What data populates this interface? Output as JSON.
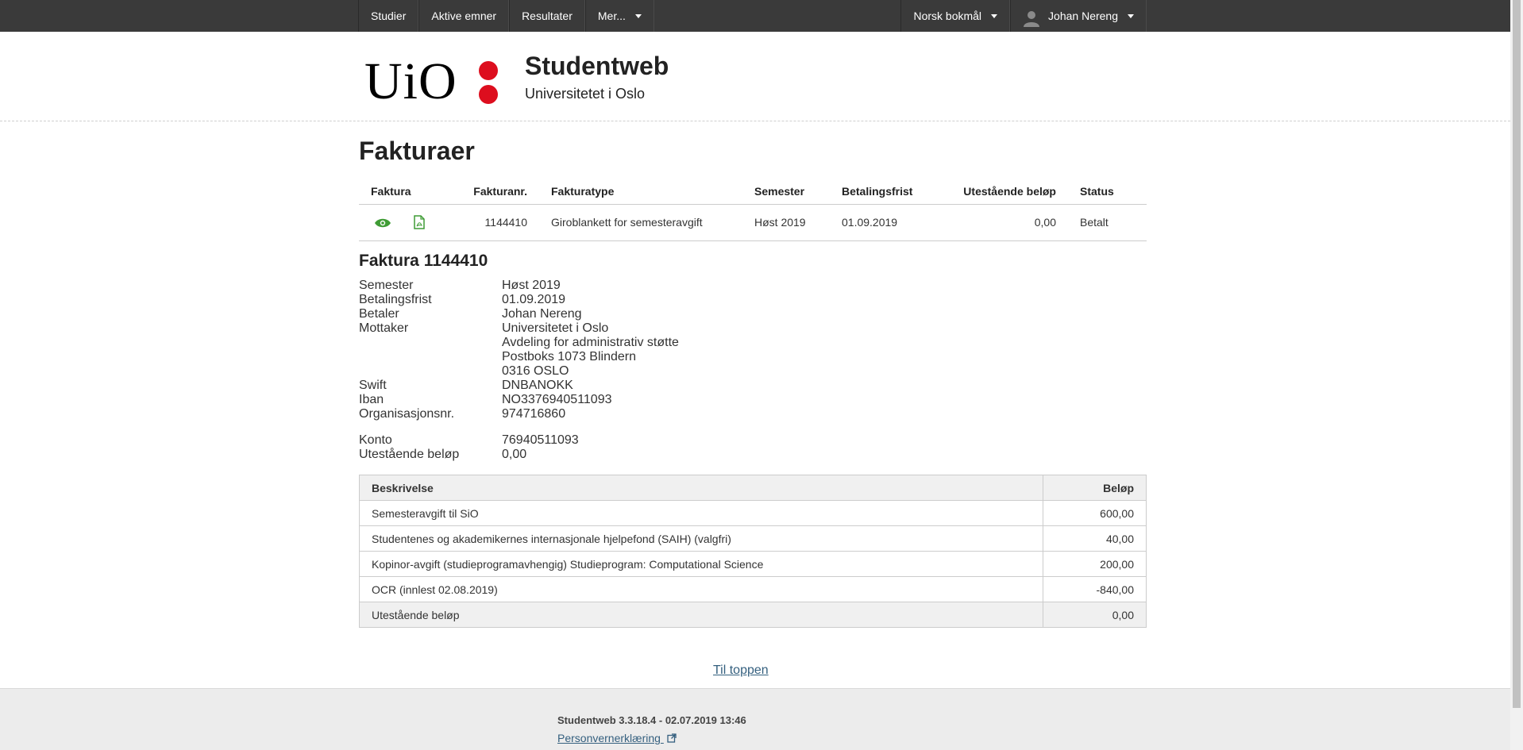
{
  "nav": {
    "items": [
      {
        "label": "Studier"
      },
      {
        "label": "Aktive emner"
      },
      {
        "label": "Resultater"
      },
      {
        "label": "Mer..."
      }
    ],
    "language": "Norsk bokmål",
    "user": "Johan Nereng"
  },
  "header": {
    "logo_text": "UiO",
    "title": "Studentweb",
    "subtitle": "Universitetet i Oslo"
  },
  "page": {
    "title": "Fakturaer"
  },
  "invoices": {
    "headers": [
      "Faktura",
      "Fakturanr.",
      "Fakturatype",
      "Semester",
      "Betalingsfrist",
      "Utestående beløp",
      "Status"
    ],
    "rows": [
      {
        "number": "1144410",
        "type": "Giroblankett for semesteravgift",
        "semester": "Høst 2019",
        "due": "01.09.2019",
        "outstanding": "0,00",
        "status": "Betalt"
      }
    ]
  },
  "detail": {
    "title": "Faktura 1144410",
    "fields": [
      {
        "label": "Semester",
        "value": "Høst 2019"
      },
      {
        "label": "Betalingsfrist",
        "value": "01.09.2019"
      },
      {
        "label": "Betaler",
        "value": "Johan Nereng"
      },
      {
        "label": "Mottaker",
        "value": [
          "Universitetet i Oslo",
          "Avdeling for administrativ støtte",
          "Postboks 1073 Blindern",
          "0316 OSLO"
        ]
      },
      {
        "label": "Swift",
        "value": "DNBANOKK"
      },
      {
        "label": "Iban",
        "value": "NO3376940511093"
      },
      {
        "label": "Organisasjonsnr.",
        "value": "974716860"
      },
      {
        "label": "Konto",
        "value": "76940511093"
      },
      {
        "label": "Utestående beløp",
        "value": "0,00"
      }
    ]
  },
  "lines": {
    "headers": [
      "Beskrivelse",
      "Beløp"
    ],
    "rows": [
      {
        "desc": "Semesteravgift til SiO",
        "amount": "600,00"
      },
      {
        "desc": "Studentenes og akademikernes internasjonale hjelpefond (SAIH) (valgfri)",
        "amount": "40,00"
      },
      {
        "desc": "Kopinor-avgift (studieprogramavhengig) Studieprogram: Computational Science",
        "amount": "200,00"
      },
      {
        "desc": "OCR (innlest 02.08.2019)",
        "amount": "-840,00"
      }
    ],
    "total": {
      "desc": "Utestående beløp",
      "amount": "0,00"
    }
  },
  "links": {
    "to_top": "Til toppen"
  },
  "footer": {
    "version": "Studentweb 3.3.18.4 - 02.07.2019 13:46",
    "privacy": "Personvernerklæring"
  },
  "colors": {
    "topbar": "#3a3a3a",
    "uio_red": "#dd0e1e",
    "icon_green": "#3f9c35",
    "link": "#35607f"
  }
}
